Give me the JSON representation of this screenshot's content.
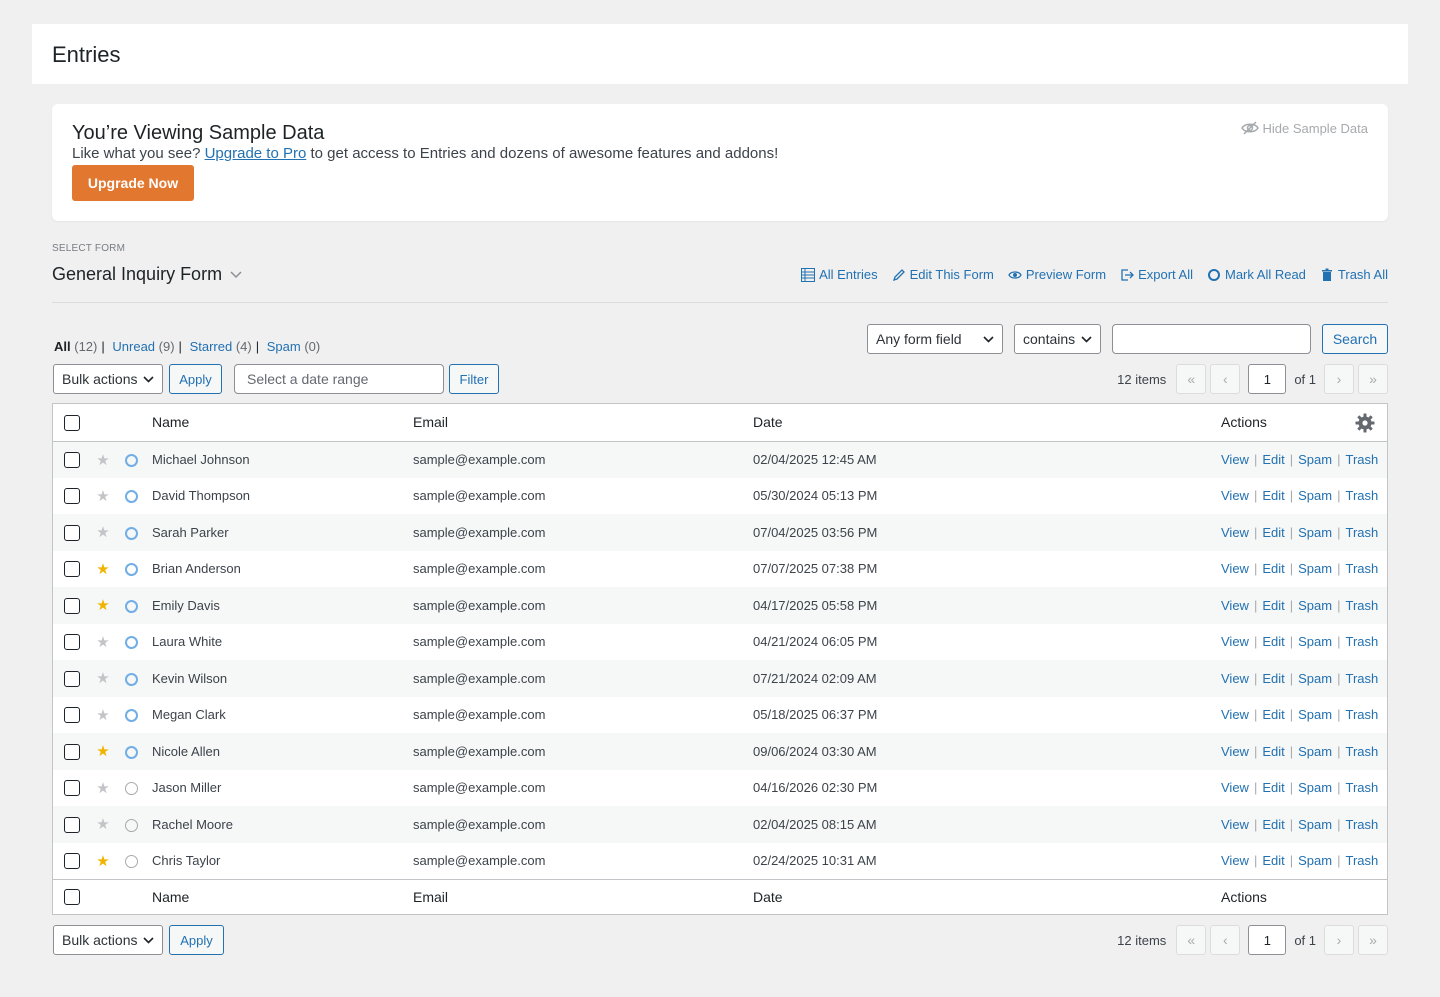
{
  "page": {
    "title": "Entries"
  },
  "notice": {
    "title": "You’re Viewing Sample Data",
    "desc_before": "Like what you see? ",
    "desc_link": "Upgrade to Pro",
    "desc_after": " to get access to Entries and dozens of awesome features and addons!",
    "button": "Upgrade Now",
    "hide_label": "Hide Sample Data"
  },
  "form_selector": {
    "label": "SELECT FORM",
    "value": "General Inquiry Form"
  },
  "top_actions": [
    "All Entries",
    "Edit This Form",
    "Preview Form",
    "Export All",
    "Mark All Read",
    "Trash All"
  ],
  "filters": {
    "all": "All",
    "all_count": "(12)",
    "unread": "Unread",
    "unread_count": "(9)",
    "starred": "Starred",
    "starred_count": "(4)",
    "spam": "Spam",
    "spam_count": "(0)"
  },
  "search": {
    "field": "Any form field",
    "operator": "contains",
    "value": "",
    "button": "Search"
  },
  "toolbar": {
    "bulk": "Bulk actions",
    "apply": "Apply",
    "date_placeholder": "Select a date range",
    "filter": "Filter"
  },
  "pagination": {
    "items": "12 items",
    "first": "«",
    "prev": "‹",
    "page": "1",
    "of": "of 1",
    "next": "›",
    "last": "»"
  },
  "table": {
    "columns": {
      "name": "Name",
      "email": "Email",
      "date": "Date",
      "actions": "Actions"
    },
    "row_actions": [
      "View",
      "Edit",
      "Spam",
      "Trash"
    ],
    "rows": [
      {
        "name": "Michael Johnson",
        "email": "sample@example.com",
        "date": "02/04/2025 12:45 AM",
        "starred": false,
        "unread": true
      },
      {
        "name": "David Thompson",
        "email": "sample@example.com",
        "date": "05/30/2024 05:13 PM",
        "starred": false,
        "unread": true
      },
      {
        "name": "Sarah Parker",
        "email": "sample@example.com",
        "date": "07/04/2025 03:56 PM",
        "starred": false,
        "unread": true
      },
      {
        "name": "Brian Anderson",
        "email": "sample@example.com",
        "date": "07/07/2025 07:38 PM",
        "starred": true,
        "unread": true
      },
      {
        "name": "Emily Davis",
        "email": "sample@example.com",
        "date": "04/17/2025 05:58 PM",
        "starred": true,
        "unread": true
      },
      {
        "name": "Laura White",
        "email": "sample@example.com",
        "date": "04/21/2024 06:05 PM",
        "starred": false,
        "unread": true
      },
      {
        "name": "Kevin Wilson",
        "email": "sample@example.com",
        "date": "07/21/2024 02:09 AM",
        "starred": false,
        "unread": true
      },
      {
        "name": "Megan Clark",
        "email": "sample@example.com",
        "date": "05/18/2025 06:37 PM",
        "starred": false,
        "unread": true
      },
      {
        "name": "Nicole Allen",
        "email": "sample@example.com",
        "date": "09/06/2024 03:30 AM",
        "starred": true,
        "unread": true
      },
      {
        "name": "Jason Miller",
        "email": "sample@example.com",
        "date": "04/16/2026 02:30 PM",
        "starred": false,
        "unread": false
      },
      {
        "name": "Rachel Moore",
        "email": "sample@example.com",
        "date": "02/04/2025 08:15 AM",
        "starred": false,
        "unread": false
      },
      {
        "name": "Chris Taylor",
        "email": "sample@example.com",
        "date": "02/24/2025 10:31 AM",
        "starred": true,
        "unread": false
      }
    ]
  },
  "colors": {
    "accent": "#2271b1",
    "upgrade": "#e27730",
    "star_on": "#f0b400",
    "unread_ring": "#72aee6"
  }
}
